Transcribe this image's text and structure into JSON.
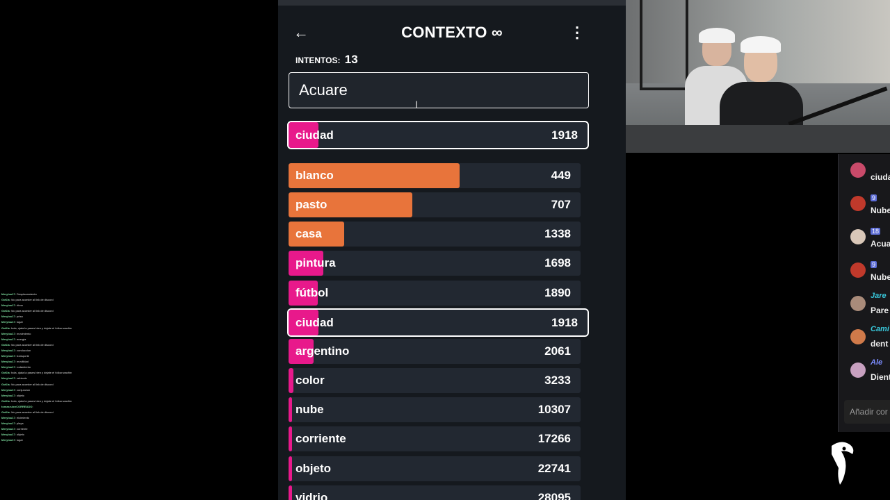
{
  "game": {
    "title": "CONTEXTO",
    "title_icon": "∞",
    "back_icon": "←",
    "menu_icon": "⋮",
    "attempts_label": "INTENTOS:",
    "attempts_value": "13",
    "input_value": "Acuare",
    "last_guess": {
      "word": "ciudad",
      "rank": "1918",
      "color": "#e8198b",
      "fill": 0.1
    },
    "guesses": [
      {
        "word": "blanco",
        "rank": "449",
        "color": "#e8743b",
        "fill": 0.585
      },
      {
        "word": "pasto",
        "rank": "707",
        "color": "#e8743b",
        "fill": 0.424
      },
      {
        "word": "casa",
        "rank": "1338",
        "color": "#e8743b",
        "fill": 0.19
      },
      {
        "word": "pintura",
        "rank": "1698",
        "color": "#e8198b",
        "fill": 0.12
      },
      {
        "word": "fútbol",
        "rank": "1890",
        "color": "#e8198b",
        "fill": 0.1
      },
      {
        "word": "ciudad",
        "rank": "1918",
        "color": "#e8198b",
        "fill": 0.1,
        "highlight": true
      },
      {
        "word": "argentino",
        "rank": "2061",
        "color": "#e8198b",
        "fill": 0.085
      },
      {
        "word": "color",
        "rank": "3233",
        "color": "#e8198b",
        "fill": 0.017
      },
      {
        "word": "nube",
        "rank": "10307",
        "color": "#e8198b",
        "fill": 0.012
      },
      {
        "word": "corriente",
        "rank": "17266",
        "color": "#e8198b",
        "fill": 0.012
      },
      {
        "word": "objeto",
        "rank": "22741",
        "color": "#e8198b",
        "fill": 0.012
      },
      {
        "word": "vidrio",
        "rank": "28095",
        "color": "#e8198b",
        "fill": 0.012
      }
    ]
  },
  "right_chat": {
    "messages": [
      {
        "badge": "",
        "name": "",
        "text": "ciuda",
        "avatar_color": "#c94a6a",
        "name_color": "#fff"
      },
      {
        "badge": "9",
        "name": "",
        "text": "Nube",
        "avatar_color": "#c0392b",
        "name_color": "#fff"
      },
      {
        "badge": "18",
        "name": "",
        "text": "Acua",
        "avatar_color": "#d9c7b8",
        "name_color": "#fff"
      },
      {
        "badge": "9",
        "name": "",
        "text": "Nube",
        "avatar_color": "#c0392b",
        "name_color": "#fff"
      },
      {
        "badge": "",
        "name": "Jare",
        "text": "Pare",
        "avatar_color": "#a98b7a",
        "name_color": "#38c6d9"
      },
      {
        "badge": "",
        "name": "Cami",
        "text": "dent",
        "avatar_color": "#d07a4a",
        "name_color": "#38c6d9"
      },
      {
        "badge": "",
        "name": "Ale",
        "text": "Dient",
        "avatar_color": "#c7a0c0",
        "name_color": "#7b8cff"
      }
    ],
    "input_placeholder": "Añadir cor"
  },
  "left_chat": {
    "lines": [
      {
        "user": "Merylou17",
        "text": ": Desplazamiento",
        "red": false
      },
      {
        "user": "GoKla",
        "text": ": !dc para acceder al link de discord",
        "red": false
      },
      {
        "user": "Merylou17",
        "text": ": ritmo",
        "red": false
      },
      {
        "user": "GoKla",
        "text": ": !dc para acceder al link de discord",
        "red": false
      },
      {
        "user": "Merylou17",
        "text": ": prisa",
        "red": false
      },
      {
        "user": "Merylou17",
        "text": ": lugar",
        "red": false
      },
      {
        "user": "",
        "text": "",
        "red": true
      },
      {
        "user": "",
        "text": "",
        "red": true
      },
      {
        "user": "",
        "text": "",
        "red": true
      },
      {
        "user": "",
        "text": "",
        "red": true
      },
      {
        "user": "",
        "text": "",
        "red": true
      },
      {
        "user": "GoKla",
        "text": ": hola, ojala la pases bien y dejate el follow wachin",
        "red": false
      },
      {
        "user": "Merylou17",
        "text": ": movimiento",
        "red": false
      },
      {
        "user": "Merylou17",
        "text": ": energia",
        "red": false
      },
      {
        "user": "GoKla",
        "text": ": !dc para acceder al link de discord",
        "red": false
      },
      {
        "user": "Merylou17",
        "text": ": conduccion",
        "red": false
      },
      {
        "user": "",
        "text": "",
        "red": true
      },
      {
        "user": "Merylou17",
        "text": ": transporte",
        "red": false
      },
      {
        "user": "Merylou17",
        "text": ": movilidad",
        "red": false
      },
      {
        "user": "Merylou17",
        "text": ": rodamiento",
        "red": false
      },
      {
        "user": "GoKla",
        "text": ": hola, ojala la pases bien y dejate el follow wachin",
        "red": false
      },
      {
        "user": "Merylou17",
        "text": ": vehiculo",
        "red": false
      },
      {
        "user": "GoKla",
        "text": ": !dc para acceder al link de discord",
        "red": false
      },
      {
        "user": "Merylou17",
        "text": ": conjuncion",
        "red": false
      },
      {
        "user": "Merylou17",
        "text": ": objeto",
        "red": false
      },
      {
        "user": "",
        "text": "",
        "red": true
      },
      {
        "user": "",
        "text": "",
        "red": true
      },
      {
        "user": "",
        "text": "",
        "red": true
      },
      {
        "user": "",
        "text": "",
        "red": true
      },
      {
        "user": "GoKla",
        "text": ": hola, ojala la pases bien y dejate el follow wachin",
        "red": false
      },
      {
        "user": "tomasrulezCORREADO",
        "text": ": ",
        "red": false
      },
      {
        "user": "GoKla",
        "text": ": !dc para acceder al link de discord",
        "red": false
      },
      {
        "user": "Merylou17",
        "text": ": elcimiento",
        "red": false
      },
      {
        "user": "Merylou17",
        "text": ": playa",
        "red": false
      },
      {
        "user": "Merylou17",
        "text": ": corriente",
        "red": false
      },
      {
        "user": "Merylou17",
        "text": ": objeto",
        "red": false
      },
      {
        "user": "Merylou17",
        "text": ": lugar",
        "red": false
      }
    ]
  }
}
